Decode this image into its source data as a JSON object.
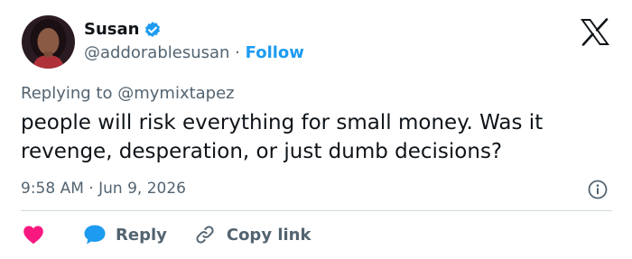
{
  "author": {
    "name": "Susan",
    "handle": "@addorablesusan",
    "separator": "·",
    "follow_label": "Follow",
    "verified": true,
    "avatar_icon": "profile-photo-icon"
  },
  "platform_logo": "x-logo-icon",
  "reply_to": {
    "prefix": "Replying to",
    "handle": "@mymixtapez"
  },
  "tweet": {
    "text": "people will risk everything for small money. Was it revenge, desperation, or just dumb decisions?",
    "time": "9:58 AM",
    "separator": "·",
    "date": "Jun 9, 2026"
  },
  "actions": {
    "like_icon": "heart-icon",
    "reply_label": "Reply",
    "copy_link_label": "Copy link"
  },
  "colors": {
    "accent": "#1d9bf0",
    "heart": "#f91880",
    "text": "#0f1419",
    "muted": "#536471",
    "divider": "#cfd9de"
  }
}
